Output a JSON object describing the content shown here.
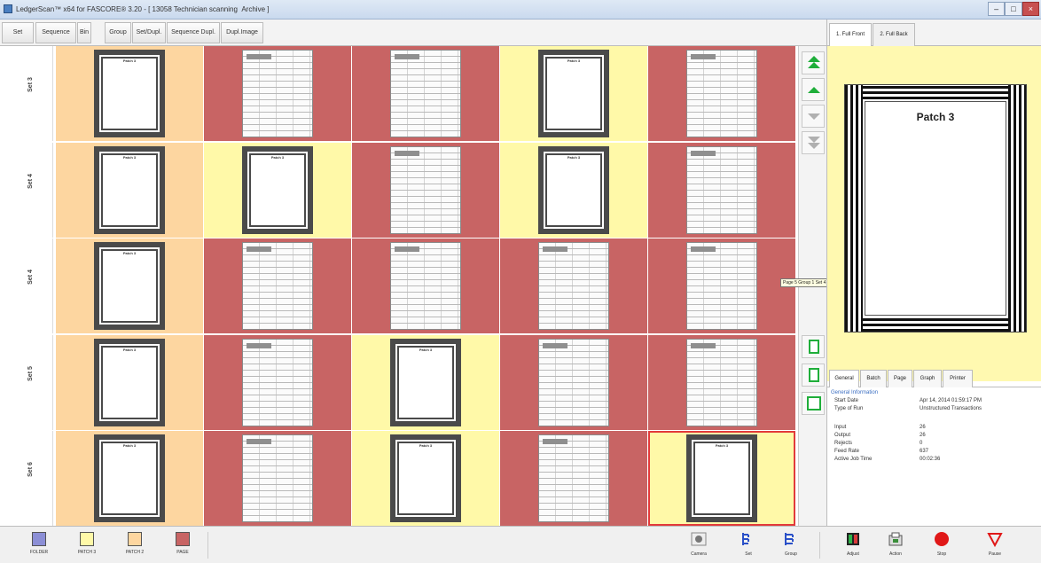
{
  "window": {
    "title": "LedgerScan™ x64 for FASCORE® 3.20 - [ 13058 Technician scanning  Archive ]"
  },
  "toolbar": {
    "buttons": [
      "Set",
      "Sequence",
      "Bin",
      "Group",
      "Set/Dupl.",
      "Sequence Dupl.",
      "Dupl.Image"
    ]
  },
  "colors": {
    "folder": "#8c8fd6",
    "patch3": "#fff9a8",
    "patch2": "#fdd6a0",
    "page": "#c86464"
  },
  "grid": {
    "rows": [
      {
        "label": "Set 3",
        "bg": [
          "patch2",
          "page",
          "page",
          "patch3",
          "page"
        ],
        "docs": [
          "patch",
          "form",
          "form",
          "patch",
          "form"
        ]
      },
      {
        "label": "Set 4",
        "bg": [
          "patch2",
          "patch3",
          "page",
          "patch3",
          "page"
        ],
        "docs": [
          "patch",
          "patch",
          "form",
          "patch",
          "form"
        ]
      },
      {
        "label": "Set 4",
        "bg": [
          "patch2",
          "page",
          "page",
          "page",
          "page"
        ],
        "docs": [
          "patch",
          "form",
          "form",
          "form",
          "form"
        ]
      },
      {
        "label": "Set 5",
        "bg": [
          "patch2",
          "page",
          "patch3",
          "page",
          "page"
        ],
        "docs": [
          "patch",
          "form",
          "patch",
          "form",
          "form"
        ]
      },
      {
        "label": "Set 6",
        "bg": [
          "patch2",
          "page",
          "patch3",
          "page",
          "patch3"
        ],
        "docs": [
          "patch",
          "form",
          "patch",
          "form",
          "patch"
        ]
      }
    ],
    "patch_title": "Patch 3",
    "selected": {
      "row": 4,
      "col": 4
    }
  },
  "tooltip": "Page 5 Group 1 Set 4",
  "right_panel": {
    "tabs": [
      "1. Full Front",
      "2. Full Back"
    ],
    "preview_title": "Patch 3",
    "info_tabs": [
      "General",
      "Batch",
      "Page",
      "Graph",
      "Printer"
    ],
    "section": "General Information",
    "fields": [
      {
        "k": "Start Date",
        "v": "Apr 14, 2014 01:59:17 PM"
      },
      {
        "k": "Type of Run",
        "v": "Unstructured Transactions"
      },
      {
        "k": "Input",
        "v": "26"
      },
      {
        "k": "Output",
        "v": "26"
      },
      {
        "k": "Rejects",
        "v": "0"
      },
      {
        "k": "Feed Rate",
        "v": "637"
      },
      {
        "k": "Active Job Time",
        "v": "00:02:36"
      }
    ]
  },
  "legend": [
    {
      "label": "FOLDER",
      "color": "#8c8fd6"
    },
    {
      "label": "PATCH 3",
      "color": "#fff9a8"
    },
    {
      "label": "PATCH 2",
      "color": "#fdd6a0"
    },
    {
      "label": "PAGE",
      "color": "#c86464"
    }
  ],
  "actions": [
    {
      "label": "Camera",
      "icon": "camera-icon"
    },
    {
      "label": "Set",
      "icon": "set-tree-icon"
    },
    {
      "label": "Group",
      "icon": "group-tree-icon"
    },
    {
      "label": "Adjust",
      "icon": "adjust-icon"
    },
    {
      "label": "Action",
      "icon": "action-icon"
    },
    {
      "label": "Stop",
      "icon": "stop-icon"
    },
    {
      "label": "Pause",
      "icon": "pause-icon"
    }
  ]
}
